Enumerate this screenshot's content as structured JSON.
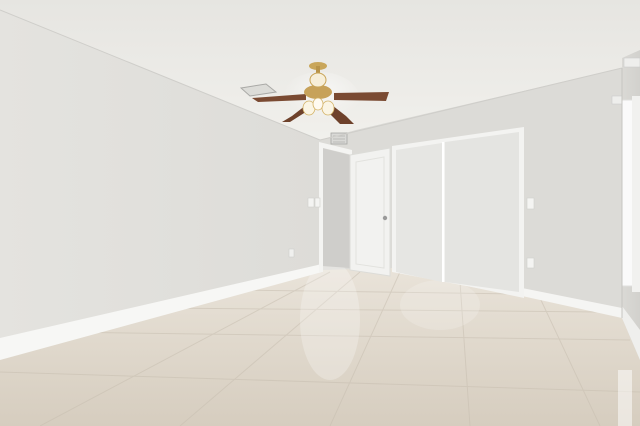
{
  "scene": {
    "colors": {
      "ceiling": "#ecebe7",
      "left_wall": "#e3e2de",
      "back_wall": "#dcdbd7",
      "right_wall": "#d8d7d3",
      "baseboard": "#f7f7f5",
      "floor_light": "#e4ddd2",
      "floor_dark": "#cfc6b8",
      "fan_blade": "#7a4a32",
      "fan_brass": "#c9a65a",
      "door": "#f2f2f0"
    },
    "objects": {
      "ceiling_fan": "ceiling-fan",
      "ceiling_vent": "ceiling-vent",
      "open_door": "interior-door",
      "closet": "closet-doors",
      "window": "window-light",
      "outlets": "wall-outlets",
      "switches": "light-switches"
    }
  }
}
